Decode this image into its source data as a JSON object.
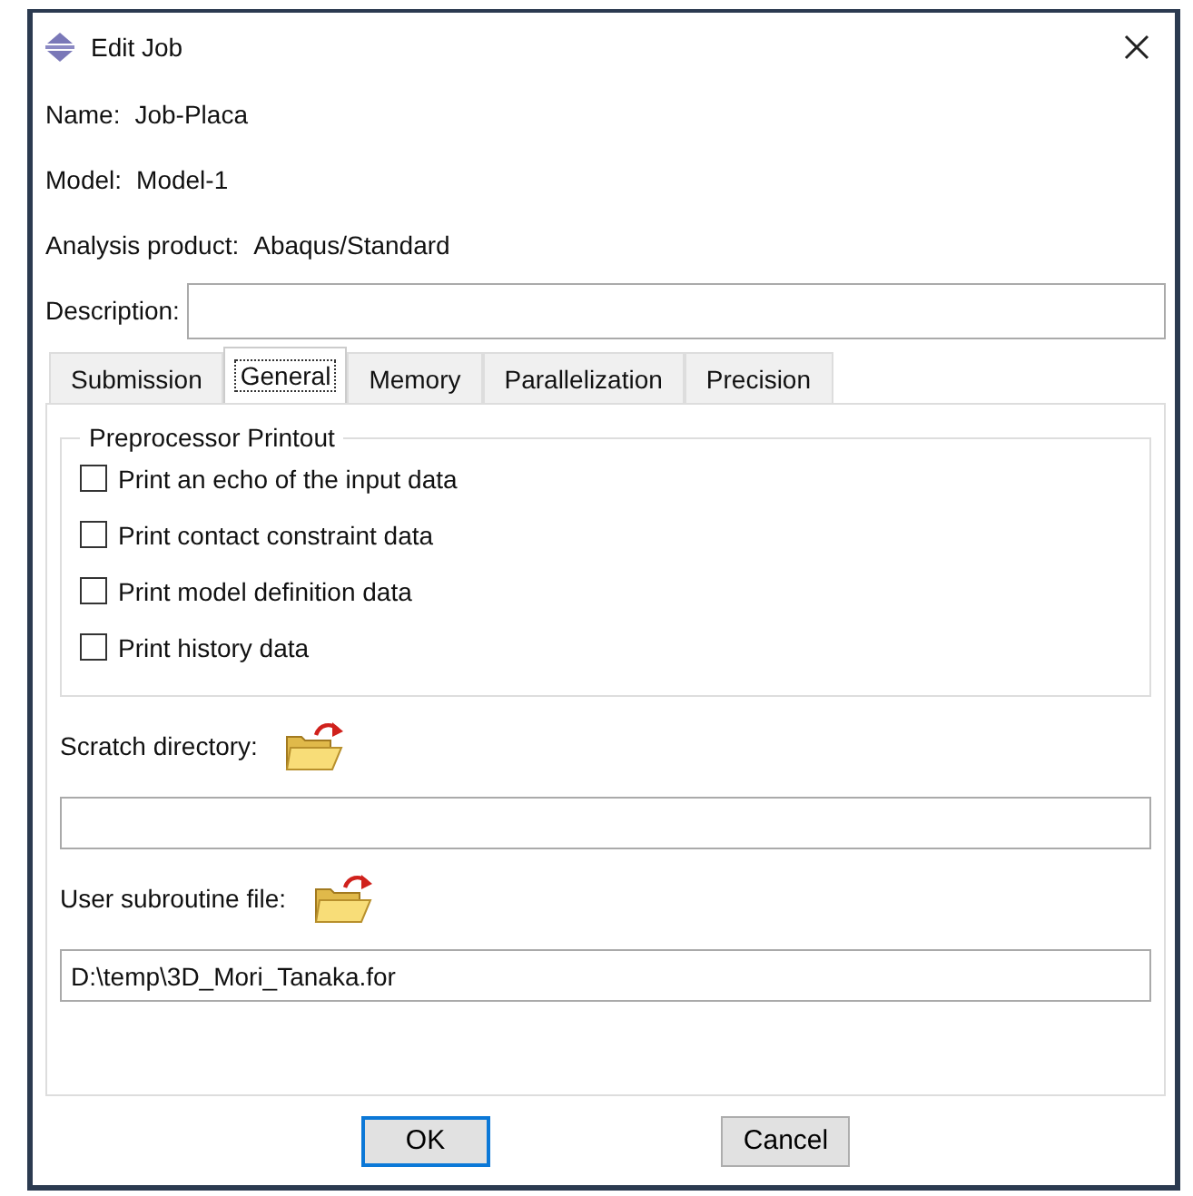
{
  "window": {
    "title": "Edit Job"
  },
  "info": [
    {
      "label": "Name:",
      "value": "Job-Placa"
    },
    {
      "label": "Model:",
      "value": "Model-1"
    },
    {
      "label": "Analysis product:",
      "value": "Abaqus/Standard"
    }
  ],
  "description": {
    "label": "Description:"
  },
  "tabs": [
    {
      "label": "Submission",
      "selected": false
    },
    {
      "label": "General",
      "selected": true
    },
    {
      "label": "Memory",
      "selected": false
    },
    {
      "label": "Parallelization",
      "selected": false
    },
    {
      "label": "Precision",
      "selected": false
    }
  ],
  "preprocessor_printout": {
    "title": "Preprocessor Printout",
    "options": [
      {
        "label": "Print an echo of the input data",
        "checked": false
      },
      {
        "label": "Print contact constraint data",
        "checked": false
      },
      {
        "label": "Print model definition data",
        "checked": false
      },
      {
        "label": "Print history data",
        "checked": false
      }
    ]
  },
  "scratch_directory": {
    "label": "Scratch directory:"
  },
  "user_subroutine_file": {
    "label": "User subroutine file:",
    "value": "D:\\temp\\3D_Mori_Tanaka.for"
  },
  "buttons": [
    {
      "label": "OK",
      "default": true
    },
    {
      "label": "Cancel",
      "default": false
    }
  ]
}
